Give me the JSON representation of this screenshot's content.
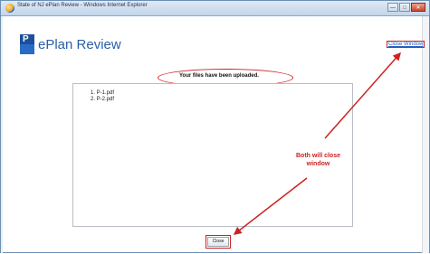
{
  "window": {
    "title": "State of NJ ePlan Review - Windows Internet Explorer",
    "controls": [
      "—",
      "□",
      "✕"
    ]
  },
  "header": {
    "app_title": "ePlan Review",
    "logo_letter": "P",
    "close_window_label": "Close Window"
  },
  "main": {
    "message": "Your files have been uploaded.",
    "files": [
      "1.  P-1.pdf",
      "2.  P-2.pdf"
    ],
    "close_button_label": "Close"
  },
  "annotation": {
    "line1": "Both will close",
    "line2": "window",
    "color": "#cc2222"
  }
}
